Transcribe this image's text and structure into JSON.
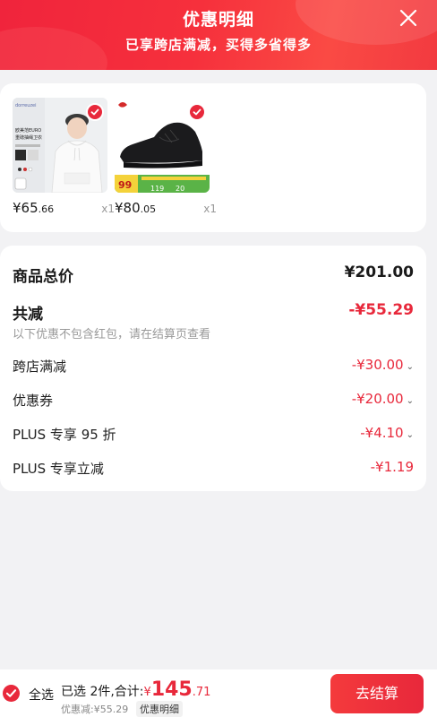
{
  "header": {
    "title": "优惠明细",
    "subtitle": "已享跨店满减，买得多省得多",
    "close_icon": "close-icon"
  },
  "products": [
    {
      "name_icon": "hoodie-product-image",
      "price_int": "¥65",
      "price_dec": ".66",
      "qty": "x1",
      "badge_lines": [
        "欧美范EURO",
        "重磅抽绳卫衣"
      ]
    },
    {
      "name_icon": "sneaker-product-image",
      "price_int": "¥80",
      "price_dec": ".05",
      "qty": "x1",
      "promo_price": "99",
      "promo_tags": [
        "119",
        "20"
      ]
    }
  ],
  "summary": {
    "total_label": "商品总价",
    "total_value": "¥201.00",
    "reduce_label": "共减",
    "reduce_value": "-¥55.29",
    "note": "以下优惠不包含红包，请在结算页查看",
    "items": [
      {
        "label": "跨店满减",
        "value": "-¥30.00",
        "expandable": true
      },
      {
        "label": "优惠券",
        "value": "-¥20.00",
        "expandable": true
      },
      {
        "label": "PLUS 专享 95 折",
        "value": "-¥4.10",
        "expandable": true
      },
      {
        "label": "PLUS 专享立减",
        "value": "-¥1.19",
        "expandable": false
      }
    ]
  },
  "bottom": {
    "select_all": "全选",
    "selected_text": "已选 2件,合计:",
    "yen": "¥",
    "total_int": "145",
    "total_dec": ".71",
    "discount_text": "优惠减:¥55.29",
    "detail_link": "优惠明细",
    "checkout": "去结算"
  },
  "colors": {
    "accent": "#e8283b",
    "header": "#f0243c"
  }
}
